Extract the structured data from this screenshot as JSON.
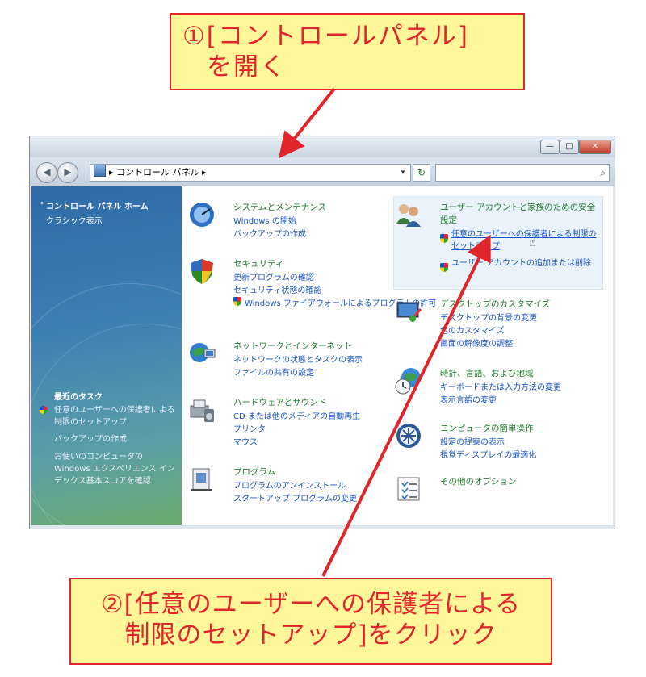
{
  "callouts": {
    "step1_line1": "①[コントロールパネル]",
    "step1_line2": "を開く",
    "step2_line1": "②[任意のユーザーへの保護者による",
    "step2_line2": "制限のセットアップ]をクリック"
  },
  "colors": {
    "callout_bg": "#fff79a",
    "callout_border": "#e0262a",
    "arrow": "#e0262a",
    "link": "#1a55c8",
    "category_title": "#1f7a2a"
  },
  "window": {
    "controls": {
      "minimize": "—",
      "maximize": "□",
      "close": "✕"
    },
    "address": {
      "separator": "▸",
      "path": "コントロール パネル",
      "trail": "▸",
      "dropdown": "▾"
    },
    "refresh_icon": "refresh-icon",
    "search": {
      "icon": "⌕",
      "placeholder": ""
    }
  },
  "sidebar": {
    "home": "コントロール パネル ホーム",
    "classic": "クラシック表示",
    "recent_heading": "最近のタスク",
    "recent_tasks": [
      "任意のユーザーへの保護者による制限のセットアップ",
      "バックアップの作成",
      "お使いのコンピュータの Windows エクスペリエンス インデックス基本スコアを確認"
    ]
  },
  "categories": [
    {
      "icon": "system-maintenance-icon",
      "title": "システムとメンテナンス",
      "links": [
        "Windows の開始",
        "バックアップの作成"
      ]
    },
    {
      "icon": "security-shield-icon",
      "title": "セキュリティ",
      "links": [
        "更新プログラムの確認",
        "セキュリティ状態の確認",
        "Windows ファイアウォールによるプログラムの許可"
      ]
    },
    {
      "icon": "network-internet-icon",
      "title": "ネットワークとインターネット",
      "links": [
        "ネットワークの状態とタスクの表示",
        "ファイルの共有の設定"
      ]
    },
    {
      "icon": "hardware-sound-icon",
      "title": "ハードウェアとサウンド",
      "links": [
        "CD または他のメディアの自動再生",
        "プリンタ",
        "マウス"
      ]
    },
    {
      "icon": "programs-icon",
      "title": "プログラム",
      "links": [
        "プログラムのアンインストール",
        "スタートアップ プログラムの変更"
      ]
    },
    {
      "icon": "user-accounts-icon",
      "title": "ユーザー アカウントと家族のための安全設定",
      "links": [
        "任意のユーザーへの保護者による制限のセットアップ",
        "ユーザー アカウントの追加または削除"
      ]
    },
    {
      "icon": "appearance-icon",
      "title": "デスクトップのカスタマイズ",
      "links": [
        "デスクトップの背景の変更",
        "色のカスタマイズ",
        "画面の解像度の調整"
      ]
    },
    {
      "icon": "clock-globe-icon",
      "title": "時計、言語、および地域",
      "links": [
        "キーボードまたは入力方法の変更",
        "表示言語の変更"
      ]
    },
    {
      "icon": "ease-of-access-icon",
      "title": "コンピュータの簡単操作",
      "links": [
        "設定の提案の表示",
        "視覚ディスプレイの最適化"
      ]
    },
    {
      "icon": "additional-options-icon",
      "title": "その他のオプション",
      "links": []
    }
  ]
}
